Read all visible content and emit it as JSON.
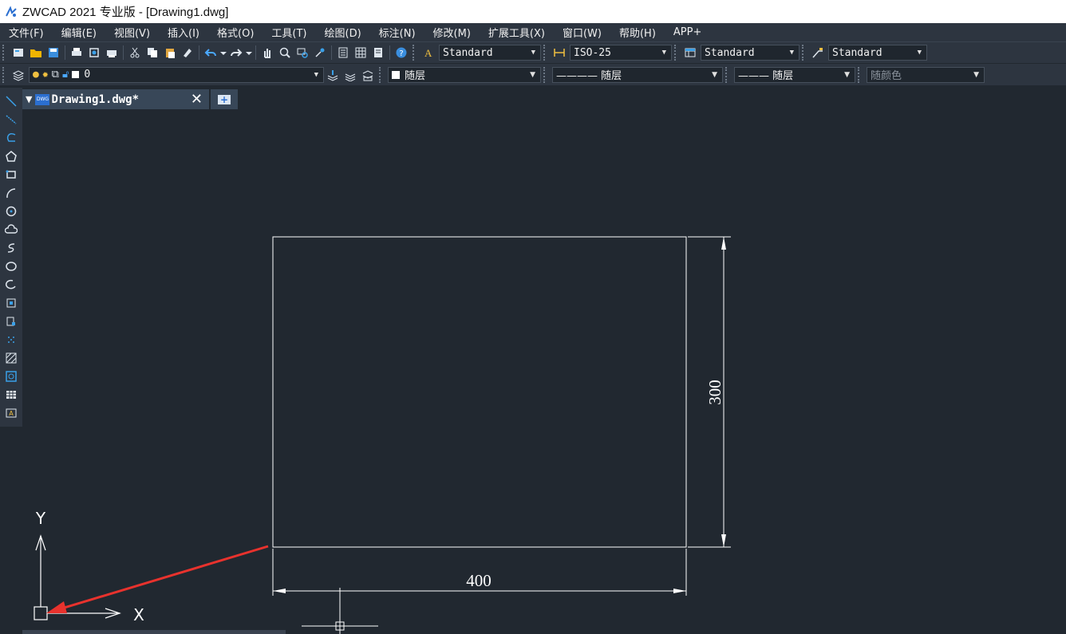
{
  "app": {
    "title": "ZWCAD 2021 专业版 - [Drawing1.dwg]"
  },
  "menu": [
    {
      "label": "文件(F)"
    },
    {
      "label": "编辑(E)"
    },
    {
      "label": "视图(V)"
    },
    {
      "label": "插入(I)"
    },
    {
      "label": "格式(O)"
    },
    {
      "label": "工具(T)"
    },
    {
      "label": "绘图(D)"
    },
    {
      "label": "标注(N)"
    },
    {
      "label": "修改(M)"
    },
    {
      "label": "扩展工具(X)"
    },
    {
      "label": "窗口(W)"
    },
    {
      "label": "帮助(H)"
    },
    {
      "label": "APP+"
    }
  ],
  "toolbar1": {
    "text_style": "Standard",
    "dim_style": "ISO-25",
    "table_style": "Standard",
    "multileader_style": "Standard"
  },
  "toolbar2": {
    "layer": "0",
    "color": "随层",
    "linetype": "———— 随层",
    "lineweight": "——— 随层",
    "plot_style": "随颜色"
  },
  "tab": {
    "doc_icon": "DWG",
    "name": "Drawing1.dwg*",
    "close": "✕",
    "new": "+"
  },
  "drawing": {
    "dim_horizontal": "400",
    "dim_vertical": "300",
    "ucs_x": "X",
    "ucs_y": "Y"
  },
  "colors": {
    "canvas_bg": "#212830",
    "toolbar_bg": "#2d3540",
    "entity": "#ffffff",
    "arrow_annotation": "#e8322d",
    "accent_icon": "#3aa0e8"
  }
}
